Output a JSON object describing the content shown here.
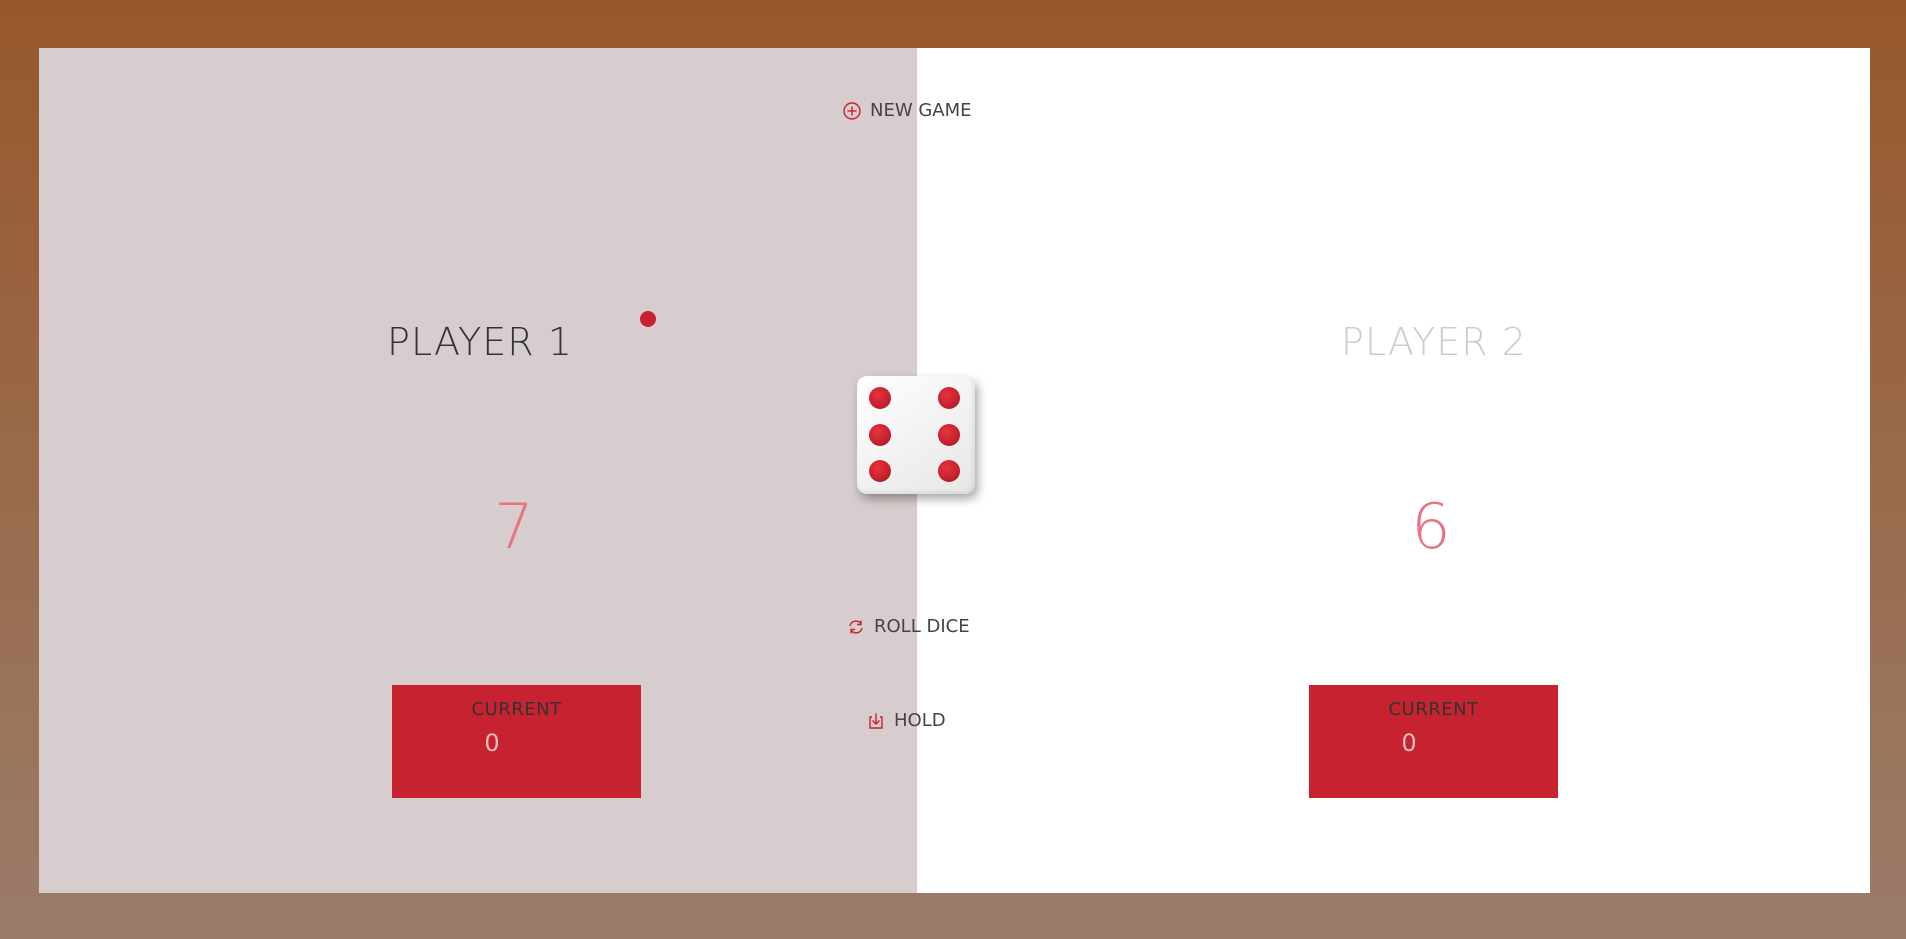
{
  "buttons": {
    "new_game": "NEW GAME",
    "roll_dice": "ROLL DICE",
    "hold": "HOLD"
  },
  "players": [
    {
      "name": "PLAYER 1",
      "score": "7",
      "current_label": "CURRENT",
      "current_score": "0",
      "active": true
    },
    {
      "name": "PLAYER 2",
      "score": "6",
      "current_label": "CURRENT",
      "current_score": "0",
      "active": false
    }
  ],
  "dice": {
    "value": 6
  },
  "colors": {
    "accent": "#c7222f",
    "active_panel": "#d8cdce",
    "inactive_panel": "#ffffff",
    "score": "#e8747f"
  },
  "icons": {
    "new_game": "plus-circle-icon",
    "roll_dice": "refresh-icon",
    "hold": "download-icon"
  }
}
